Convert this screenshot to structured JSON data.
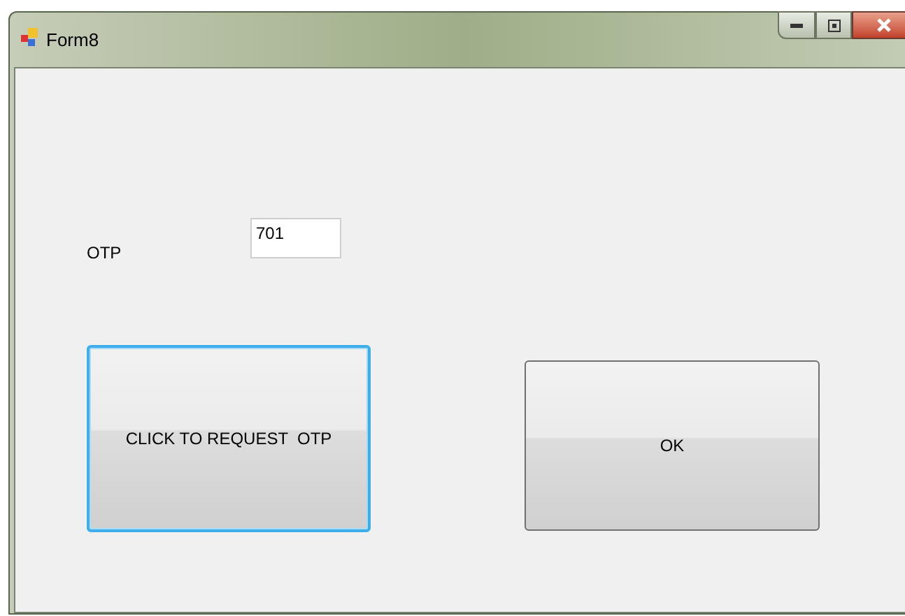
{
  "window": {
    "title": "Form8"
  },
  "otp_label": "OTP",
  "otp_field": {
    "value": "701"
  },
  "buttons": [
    {
      "label": "CLICK TO REQUEST  OTP",
      "focused": true
    },
    {
      "label": "OK",
      "focused": false
    }
  ]
}
